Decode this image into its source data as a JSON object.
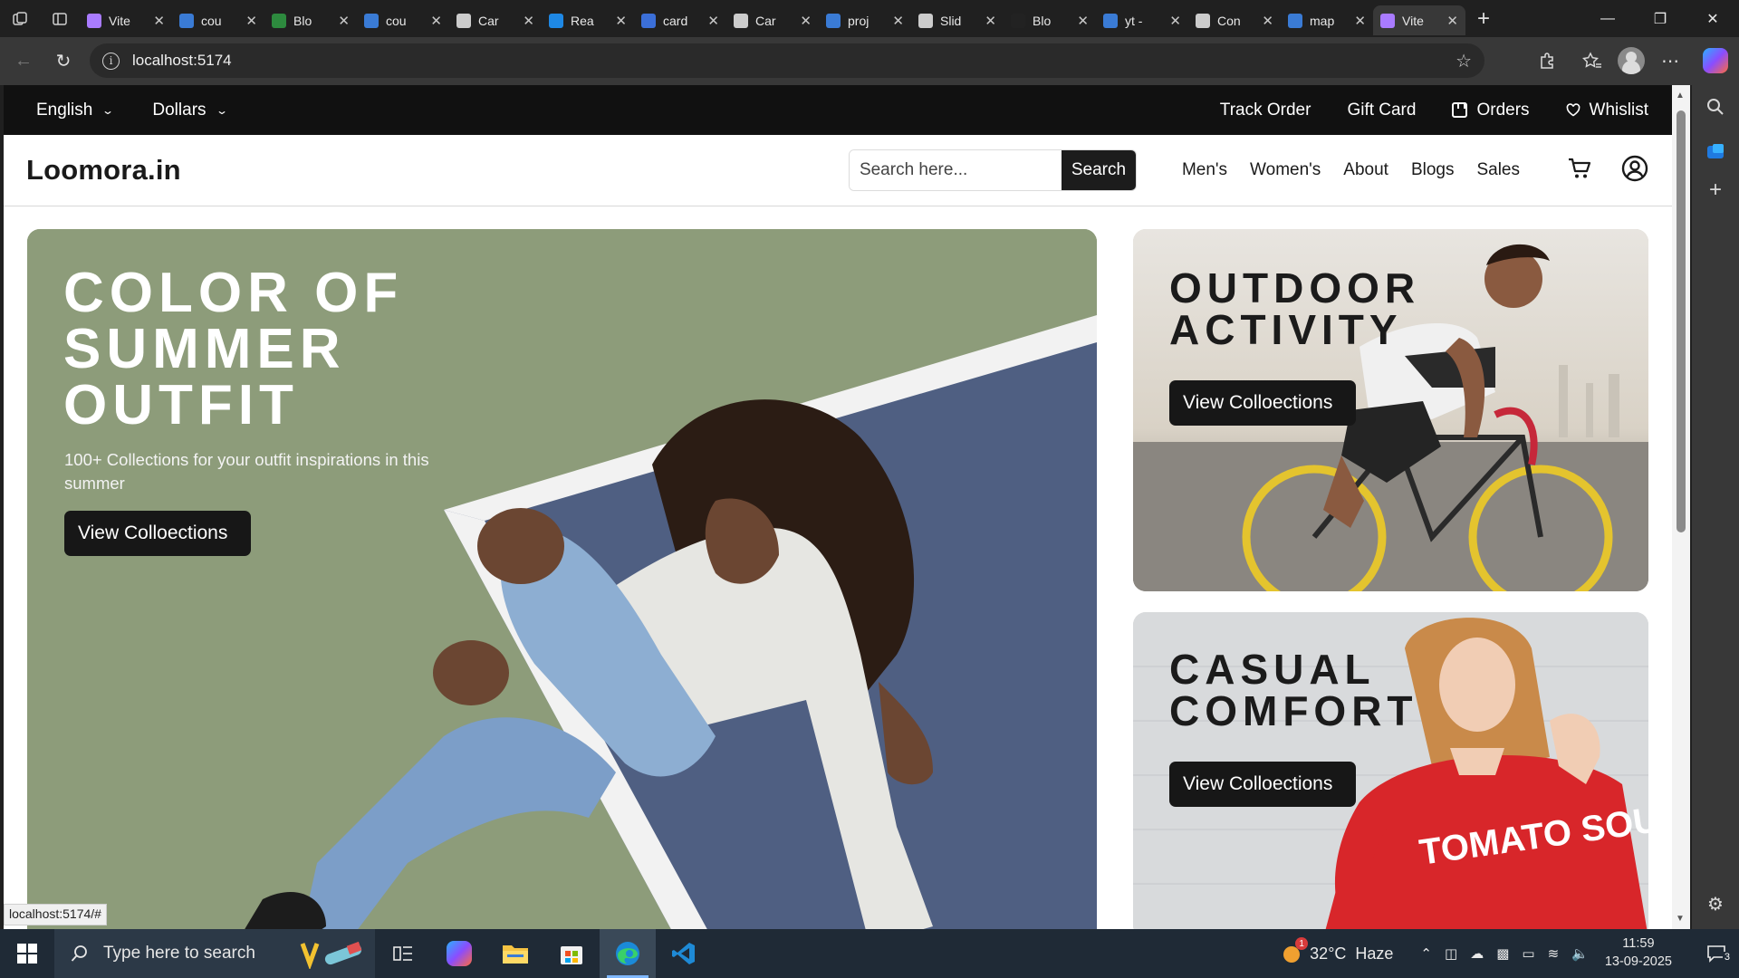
{
  "browser": {
    "tabs": [
      {
        "title": "Vite",
        "icon": "vite-icon",
        "color": "#a97bff"
      },
      {
        "title": "cou",
        "icon": "search-icon",
        "color": "#3a7bd5"
      },
      {
        "title": "Blo",
        "icon": "blog-icon",
        "color": "#2d8a3e"
      },
      {
        "title": "cou",
        "icon": "search-icon",
        "color": "#3a7bd5"
      },
      {
        "title": "Car",
        "icon": "square-icon",
        "color": "#cccccc"
      },
      {
        "title": "Rea",
        "icon": "play-icon",
        "color": "#1e88e5"
      },
      {
        "title": "card",
        "icon": "card-icon",
        "color": "#3b6fd8"
      },
      {
        "title": "Car",
        "icon": "codepen-icon",
        "color": "#cccccc"
      },
      {
        "title": "proj",
        "icon": "search-icon",
        "color": "#3a7bd5"
      },
      {
        "title": "Slid",
        "icon": "codepen-icon",
        "color": "#cccccc"
      },
      {
        "title": "Blo",
        "icon": "github-icon",
        "color": "#222222"
      },
      {
        "title": "yt -",
        "icon": "search-icon",
        "color": "#3a7bd5"
      },
      {
        "title": "Con",
        "icon": "openai-icon",
        "color": "#cccccc"
      },
      {
        "title": "map",
        "icon": "search-icon",
        "color": "#3a7bd5"
      },
      {
        "title": "Vite",
        "icon": "vite-icon",
        "color": "#a97bff",
        "active": true
      }
    ],
    "address": "localhost:5174",
    "status_link": "localhost:5174/#"
  },
  "site": {
    "topbar": {
      "language": "English",
      "currency": "Dollars",
      "links": [
        "Track Order",
        "Gift Card",
        "Orders",
        "Whislist"
      ]
    },
    "logo": "Loomora.in",
    "search": {
      "placeholder": "Search here...",
      "button": "Search"
    },
    "nav": [
      "Men's",
      "Women's",
      "About",
      "Blogs",
      "Sales"
    ]
  },
  "hero": {
    "main": {
      "heading": "COLOR OF SUMMER OUTFIT",
      "subtext": "100+ Collections for your outfit inspirations in this summer",
      "button": "View Colloections"
    },
    "side1": {
      "heading": "OUTDOOR ACTIVITY",
      "button": "View Colloections"
    },
    "side2": {
      "heading": "CASUAL COMFORT",
      "button": "View Colloections",
      "shirt_text": "TOMATO SOUP"
    }
  },
  "taskbar": {
    "search_placeholder": "Type here to search",
    "weather": "32°C  Haze",
    "weather_badge": "1",
    "time": "11:59",
    "date": "13-09-2025",
    "notifications": "3"
  }
}
